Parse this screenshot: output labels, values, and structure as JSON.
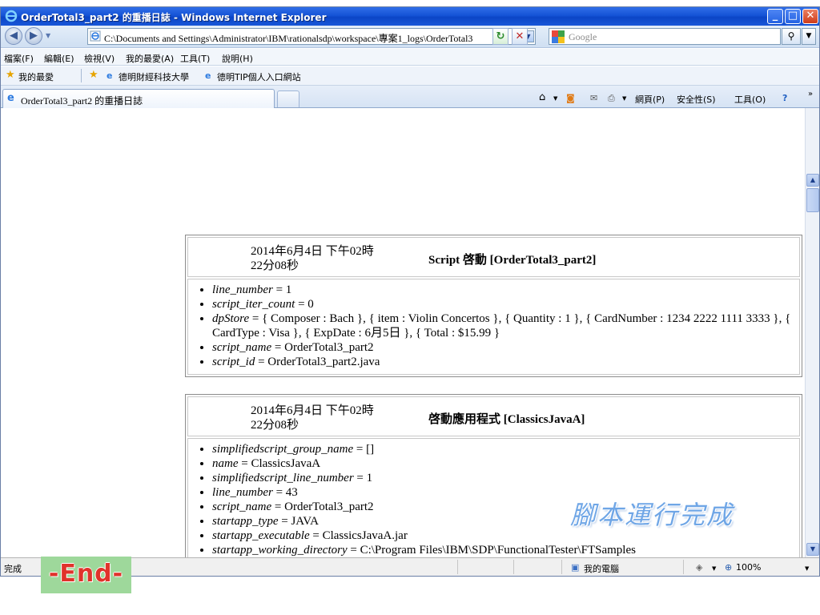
{
  "window": {
    "title": "OrderTotal3_part2 的重播日誌 - Windows Internet Explorer",
    "colors": {
      "titlebar": "#1553d6",
      "accent": "#0b45c6"
    }
  },
  "address": {
    "url": "C:\\Documents and Settings\\Administrator\\IBM\\rationalsdp\\workspace\\專案1_logs\\OrderTotal3",
    "search_placeholder": "Google"
  },
  "menu": [
    "檔案(F)",
    "編輯(E)",
    "檢視(V)",
    "我的最愛(A)",
    "工具(T)",
    "說明(H)"
  ],
  "favorites": {
    "label": "我的最愛",
    "links": [
      "德明財經科技大學",
      "德明TIP個人入口網站"
    ]
  },
  "tabs": {
    "active": "OrderTotal3_part2 的重播日誌",
    "commands": [
      "網頁(P)",
      "安全性(S)",
      "工具(O)"
    ]
  },
  "log": {
    "entry1": {
      "timestamp": "2014年6月4日 下午02時22分08秒",
      "event": "Script 啓動 [OrderTotal3_part2]",
      "items": [
        {
          "key": "line_number",
          "value": " = 1"
        },
        {
          "key": "script_iter_count",
          "value": " = 0"
        },
        {
          "key": "dpStore",
          "value": " = { Composer : Bach }, { item : Violin Concertos }, { Quantity : 1 }, { CardNumber : 1234 2222 1111 3333 }, { CardType : Visa }, { ExpDate : 6月5日 }, { Total : $15.99 }"
        },
        {
          "key": "script_name",
          "value": " = OrderTotal3_part2"
        },
        {
          "key": "script_id",
          "value": " = OrderTotal3_part2.java"
        }
      ]
    },
    "entry2": {
      "timestamp": "2014年6月4日 下午02時22分08秒",
      "event": "啓動應用程式 [ClassicsJavaA]",
      "items": [
        {
          "key": "simplifiedscript_group_name",
          "value": " = []"
        },
        {
          "key": "name",
          "value": " = ClassicsJavaA"
        },
        {
          "key": "simplifiedscript_line_number",
          "value": " = 1"
        },
        {
          "key": "line_number",
          "value": " = 43"
        },
        {
          "key": "script_name",
          "value": " = OrderTotal3_part2"
        },
        {
          "key": "startapp_type",
          "value": " = JAVA"
        },
        {
          "key": "startapp_executable",
          "value": " = ClassicsJavaA.jar"
        },
        {
          "key": "startapp_working_directory",
          "value": " = C:\\Program Files\\IBM\\SDP\\FunctionalTester\\FTSamples"
        }
      ]
    }
  },
  "overlay": {
    "watermark": "腳本運行完成",
    "end_label": "-End-"
  },
  "status": {
    "left": "完成",
    "zone": "我的電腦",
    "zoom": "100%"
  }
}
